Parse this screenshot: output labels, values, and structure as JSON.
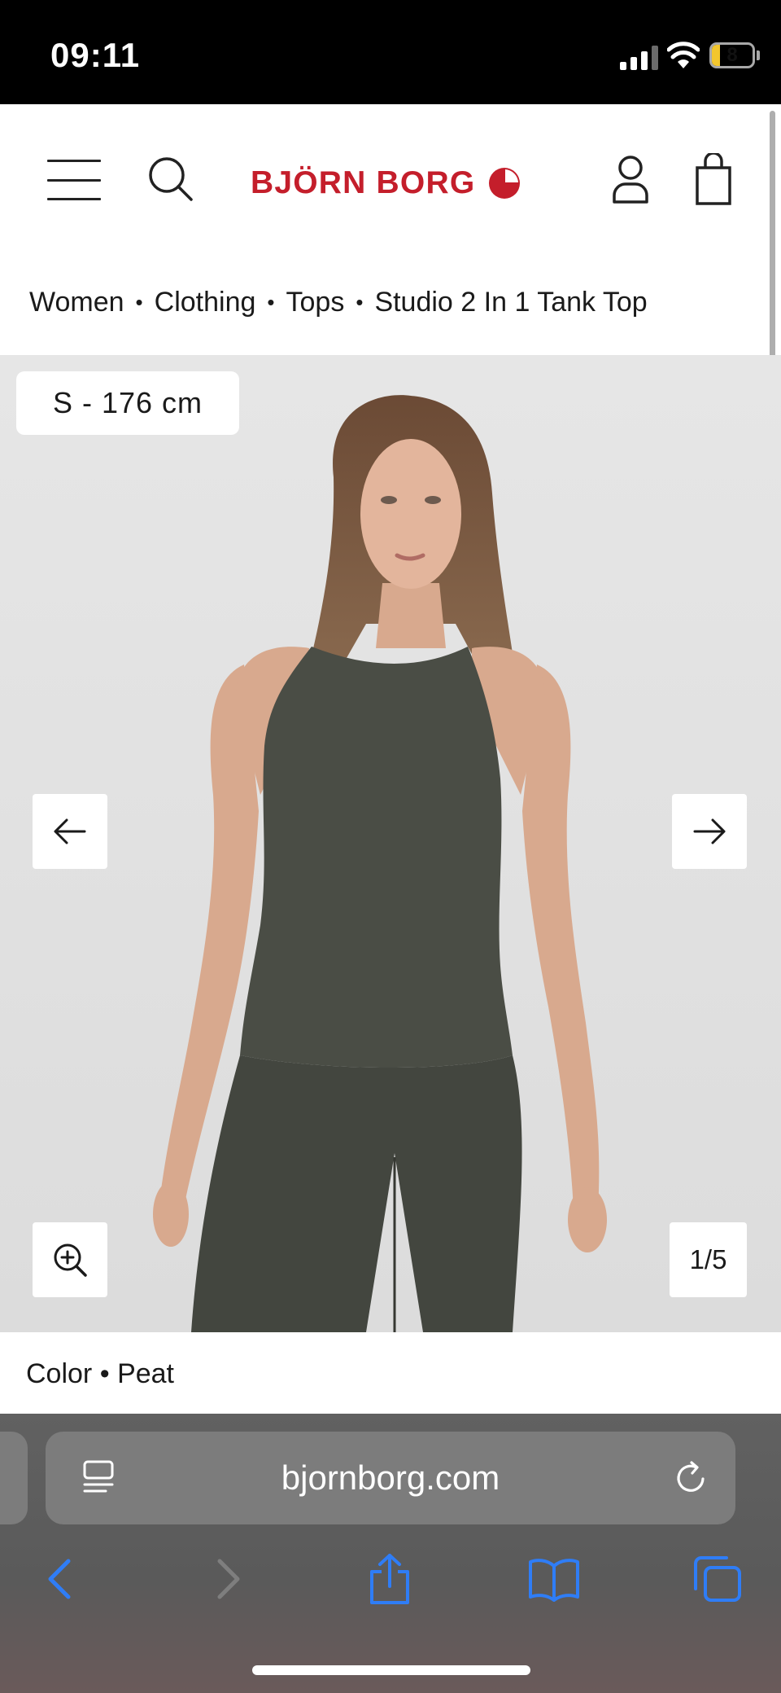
{
  "status_bar": {
    "time": "09:11",
    "battery_level": "8",
    "battery_fraction": 0.08
  },
  "header": {
    "logo_text": "BJÖRN BORG",
    "brand_color": "#c41e2b"
  },
  "breadcrumb": {
    "items": [
      "Women",
      "Clothing",
      "Tops",
      "Studio 2 In 1 Tank Top"
    ],
    "separator": "•"
  },
  "gallery": {
    "size_badge": "S - 176 cm",
    "counter": "1/5",
    "icons": {
      "prev": "arrow-left-icon",
      "next": "arrow-right-icon",
      "zoom": "zoom-in-icon"
    }
  },
  "product": {
    "color_label": "Color",
    "separator": "•",
    "color_value": "Peat"
  },
  "safari": {
    "url": "bjornborg.com",
    "accent": "#2f7df6"
  }
}
